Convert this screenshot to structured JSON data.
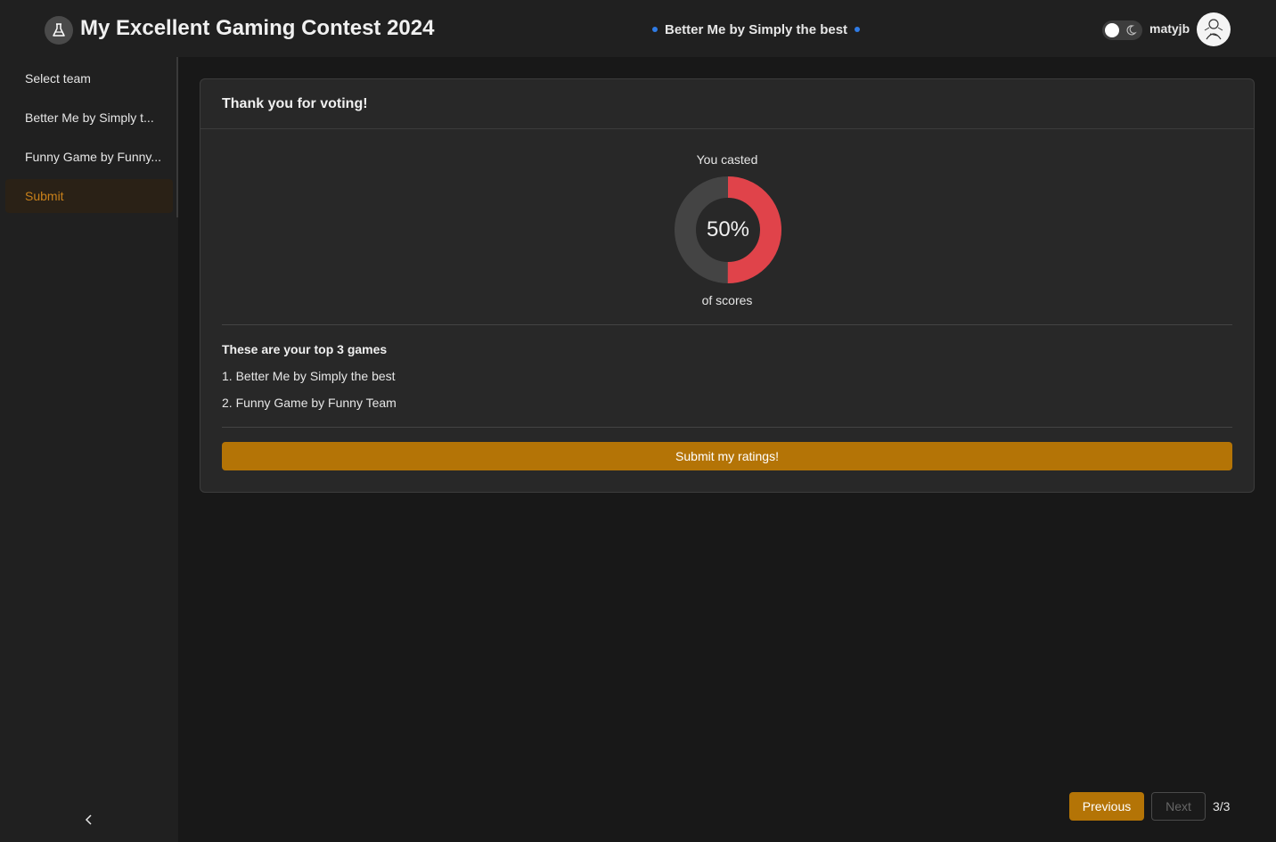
{
  "header": {
    "title": "My Excellent Gaming Contest 2024",
    "current_game": "Better Me by Simply the best",
    "username": "matyjb",
    "logo_icon": "flask-icon",
    "theme_toggle_icon": "moon-icon"
  },
  "sidebar": {
    "items": [
      {
        "label": "Select team"
      },
      {
        "label": "Better Me by Simply t..."
      },
      {
        "label": "Funny Game by Funny..."
      },
      {
        "label": "Submit"
      }
    ],
    "active_index": 3,
    "collapse_icon": "chevron-left-icon"
  },
  "card": {
    "title": "Thank you for voting!",
    "casted_label": "You casted",
    "percent_text": "50%",
    "percent_value": 50,
    "of_scores_label": "of scores",
    "top_games_title": "These are your top 3 games",
    "top_games": [
      "1. Better Me by Simply the best",
      "2. Funny Game by Funny Team"
    ],
    "submit_label": "Submit my ratings!"
  },
  "pagination": {
    "previous_label": "Previous",
    "next_label": "Next",
    "page_indicator": "3/3"
  },
  "colors": {
    "accent": "#b47406",
    "donut_fill": "#e0434a",
    "donut_track": "#444444",
    "dot": "#2f7be5"
  }
}
